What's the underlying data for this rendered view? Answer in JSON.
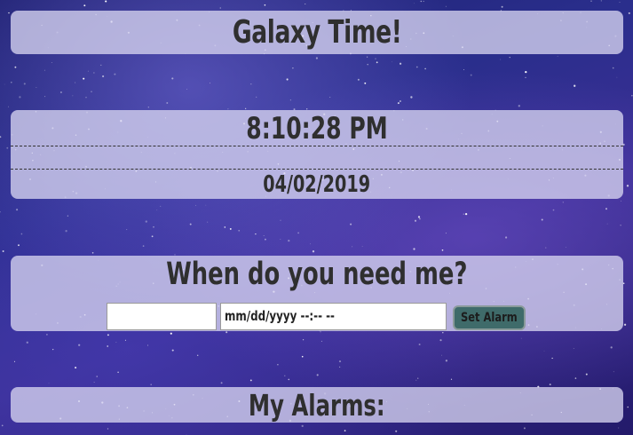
{
  "header": {
    "title": "Galaxy Time!"
  },
  "clock": {
    "time": "8:10:28 PM",
    "date": "04/02/2019"
  },
  "alarm_form": {
    "heading": "When do you need me?",
    "name_input_value": "",
    "datetime_placeholder": "mm/dd/yyyy --:-- --",
    "set_button_label": "Set Alarm"
  },
  "alarms": {
    "heading": "My Alarms:"
  },
  "colors": {
    "panel_background": "#d6d4f0",
    "button_background": "#3f6b6a",
    "text": "#2f2f2f"
  }
}
